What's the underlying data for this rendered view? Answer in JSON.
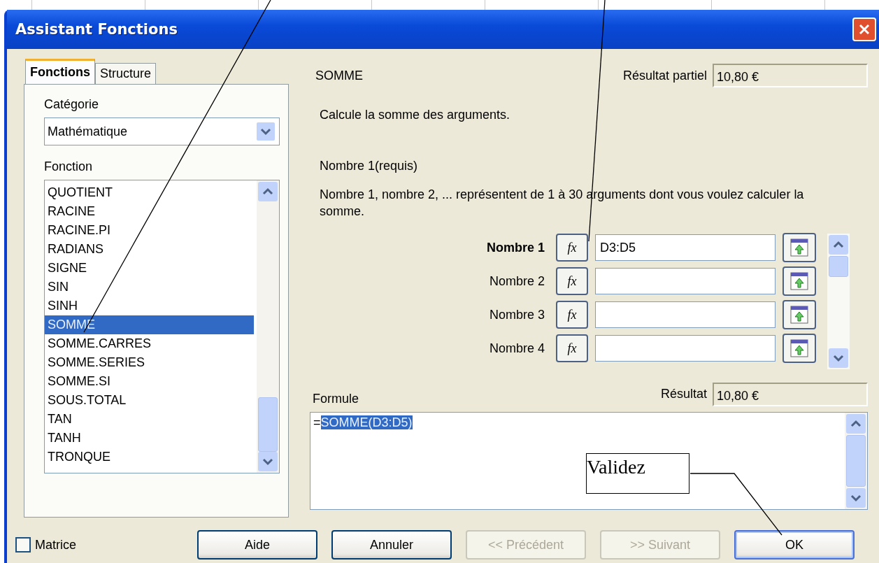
{
  "window": {
    "title": "Assistant Fonctions"
  },
  "tabs": [
    {
      "label": "Fonctions",
      "selected": true
    },
    {
      "label": "Structure",
      "selected": false
    }
  ],
  "category": {
    "label": "Catégorie",
    "value": "Mathématique"
  },
  "function_list": {
    "label": "Fonction",
    "items": [
      {
        "label": "QUOTIENT",
        "selected": false
      },
      {
        "label": "RACINE",
        "selected": false
      },
      {
        "label": "RACINE.PI",
        "selected": false
      },
      {
        "label": "RADIANS",
        "selected": false
      },
      {
        "label": "SIGNE",
        "selected": false
      },
      {
        "label": "SIN",
        "selected": false
      },
      {
        "label": "SINH",
        "selected": false
      },
      {
        "label": "SOMME",
        "selected": true
      },
      {
        "label": "SOMME.CARRES",
        "selected": false
      },
      {
        "label": "SOMME.SERIES",
        "selected": false
      },
      {
        "label": "SOMME.SI",
        "selected": false
      },
      {
        "label": "SOUS.TOTAL",
        "selected": false
      },
      {
        "label": "TAN",
        "selected": false
      },
      {
        "label": "TANH",
        "selected": false
      },
      {
        "label": "TRONQUE",
        "selected": false
      }
    ]
  },
  "function_name": "SOMME",
  "partial_result": {
    "label": "Résultat partiel",
    "value": "10,80 €"
  },
  "description": "Calcule la somme des arguments.",
  "argument_title": "Nombre  1(requis)",
  "argument_help": "Nombre 1, nombre 2, ... représentent de 1 à 30 arguments dont vous voulez calculer la somme.",
  "arguments": [
    {
      "label": "Nombre 1",
      "button": "fx",
      "value": "D3:D5",
      "active": true
    },
    {
      "label": "Nombre 2",
      "button": "fx",
      "active": false
    },
    {
      "label": "Nombre 3",
      "button": "fx",
      "active": false
    },
    {
      "label": "Nombre 4",
      "button": "fx",
      "active": false
    }
  ],
  "formula": {
    "label": "Formule",
    "prefix": "=",
    "selection": "SOMME(D3:D5)"
  },
  "result": {
    "label": "Résultat",
    "value": "10,80 €"
  },
  "array_option": {
    "label": "Matrice",
    "checked": false
  },
  "buttons": [
    {
      "label": "Aide",
      "disabled": false,
      "default": false
    },
    {
      "label": "Annuler",
      "disabled": false,
      "default": false
    },
    {
      "label": "<< Précédent",
      "disabled": true,
      "default": false
    },
    {
      "label": ">> Suivant",
      "disabled": true,
      "default": false
    },
    {
      "label": "OK",
      "disabled": false,
      "default": true
    }
  ],
  "annotation": {
    "text": "Validez"
  }
}
